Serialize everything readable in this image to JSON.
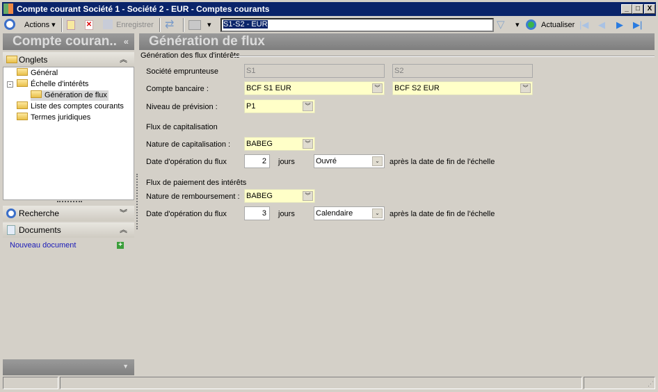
{
  "window": {
    "title": "Compte courant Société 1 - Société 2 - EUR -  Comptes courants",
    "min": "_",
    "max": "□",
    "close": "X"
  },
  "toolbar": {
    "actions": "Actions",
    "save": "Enregistrer",
    "search_value": "S1-S2 - EUR",
    "refresh": "Actualiser"
  },
  "left_header": "Compte couran..",
  "left_collapse": "«",
  "main_header": "Génération de flux",
  "panels": {
    "onglets": "Onglets",
    "recherche": "Recherche",
    "documents": "Documents",
    "new_document": "Nouveau document"
  },
  "tree": [
    "Général",
    "Échelle d'intérêts",
    "Génération de flux",
    "Liste des comptes courants",
    "Termes juridiques"
  ],
  "form": {
    "group": "Génération des flux d'intérêts",
    "societe_label": "Société emprunteuse",
    "societe1": "S1",
    "societe2": "S2",
    "compte_label": "Compte bancaire :",
    "compte1": "BCF S1 EUR",
    "compte2": "BCF S2 EUR",
    "niveau_label": "Niveau de prévision :",
    "niveau": "P1",
    "cap_title": "Flux de capitalisation",
    "cap_nature_label": "Nature de capitalisation :",
    "cap_nature": "BABEG",
    "cap_date_label": "Date d'opération du flux",
    "cap_days": "2",
    "jours": "jours",
    "cap_type": "Ouvré",
    "after": "après la date de fin de l'échelle",
    "pay_title": "Flux de paiement des intérêts",
    "pay_nature_label": "Nature de remboursement :",
    "pay_nature": "BABEG",
    "pay_date_label": "Date d'opération du flux",
    "pay_days": "3",
    "pay_type": "Calendaire"
  }
}
